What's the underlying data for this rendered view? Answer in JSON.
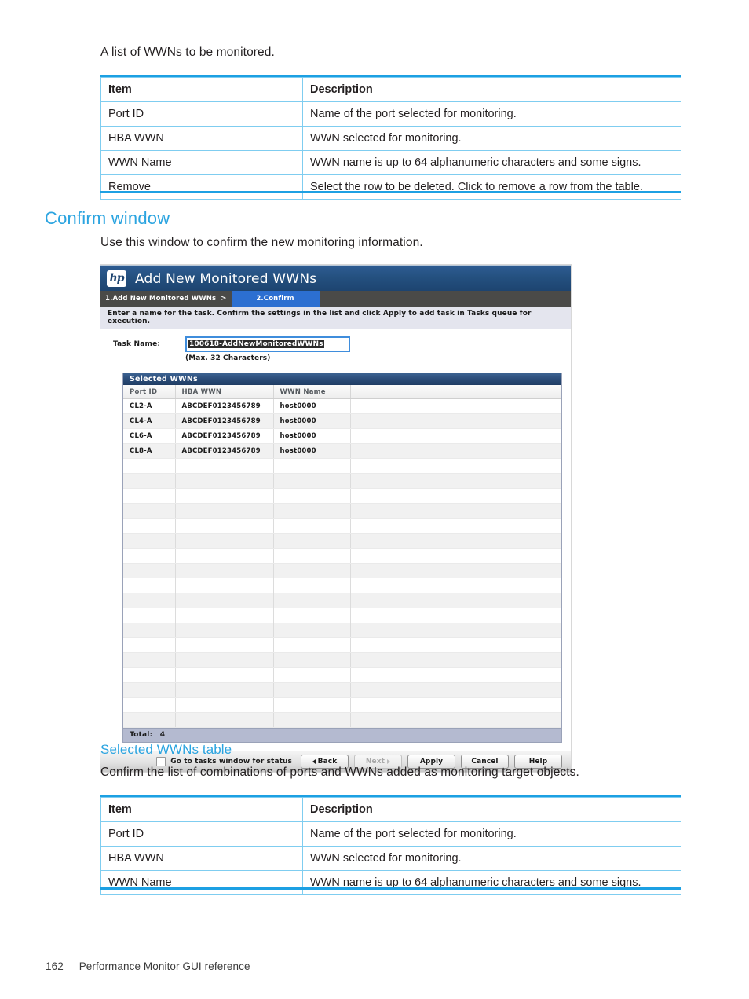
{
  "page": {
    "intro_text": "A list of WWNs to be monitored.",
    "footer_number": "162",
    "footer_title": "Performance Monitor GUI reference"
  },
  "ref_table_1": {
    "headers": [
      "Item",
      "Description"
    ],
    "rows": [
      [
        "Port ID",
        "Name of the port selected for monitoring."
      ],
      [
        "HBA WWN",
        "WWN selected for monitoring."
      ],
      [
        "WWN Name",
        "WWN name is up to 64 alphanumeric characters and some signs."
      ],
      [
        "Remove",
        "Select the row to be deleted. Click to remove a row from the table."
      ]
    ]
  },
  "section_confirm": {
    "heading": "Confirm window",
    "description": "Use this window to confirm the new monitoring information."
  },
  "app": {
    "logo_text": "hp",
    "title": "Add New Monitored WWNs",
    "breadcrumb": {
      "step1": "1.Add New Monitored WWNs",
      "separator": ">",
      "step2": "2.Confirm"
    },
    "instruction": "Enter a name for the task. Confirm the settings in the list and click Apply to add task in Tasks queue for execution.",
    "task": {
      "label": "Task Name:",
      "value": "100618-AddNewMonitoredWWNs",
      "hint": "(Max. 32 Characters)"
    },
    "wwn_panel": {
      "title": "Selected WWNs",
      "columns": [
        "Port ID",
        "HBA WWN",
        "WWN Name",
        ""
      ],
      "rows": [
        [
          "CL2-A",
          "ABCDEF0123456789",
          "host0000",
          ""
        ],
        [
          "CL4-A",
          "ABCDEF0123456789",
          "host0000",
          ""
        ],
        [
          "CL6-A",
          "ABCDEF0123456789",
          "host0000",
          ""
        ],
        [
          "CL8-A",
          "ABCDEF0123456789",
          "host0000",
          ""
        ]
      ],
      "empty_row_count": 18,
      "total_label": "Total:",
      "total_value": "4"
    },
    "footer": {
      "checkbox_label": "Go to tasks window for status",
      "back": "Back",
      "next": "Next",
      "apply": "Apply",
      "cancel": "Cancel",
      "help": "Help"
    }
  },
  "section_selected_table": {
    "heading": "Selected WWNs table",
    "description": "Confirm the list of combinations of ports and WWNs added as monitoring target objects."
  },
  "ref_table_2": {
    "headers": [
      "Item",
      "Description"
    ],
    "rows": [
      [
        "Port ID",
        "Name of the port selected for monitoring."
      ],
      [
        "HBA WWN",
        "WWN selected for monitoring."
      ],
      [
        "WWN Name",
        "WWN name is up to 64 alphanumeric characters and some signs."
      ]
    ]
  },
  "colors": {
    "accent_blue": "#2ba4e0",
    "table_border": "#7fcdf0",
    "app_title_bg": "#24507f",
    "breadcrumb_bg": "#4a4a48",
    "breadcrumb_active": "#2c6fd1"
  }
}
